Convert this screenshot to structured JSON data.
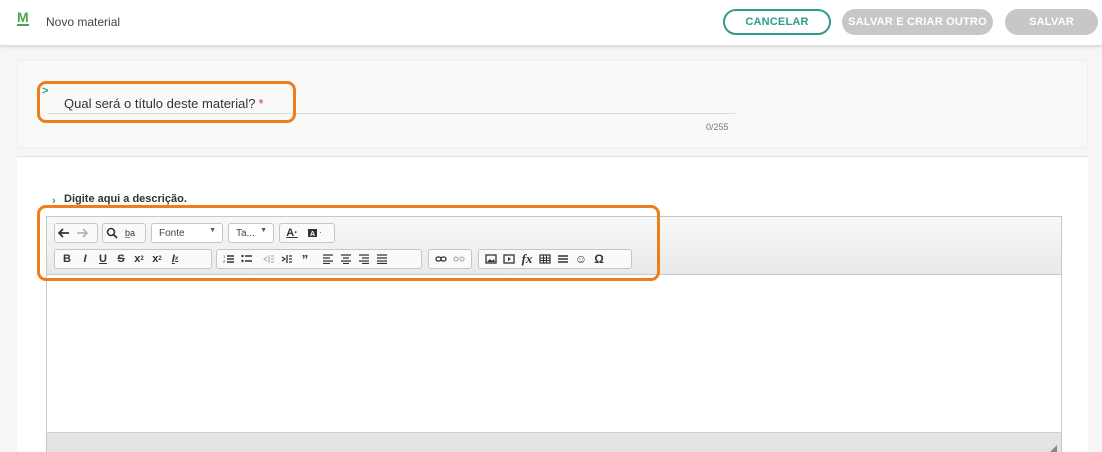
{
  "header": {
    "logo": "M",
    "title": "Novo material",
    "cancel_label": "CANCELAR",
    "save_new_label": "SALVAR E CRIAR OUTRO",
    "save_label": "SALVAR"
  },
  "title_field": {
    "label": "Qual será o título deste material?",
    "required_mark": "*",
    "counter": "0/255"
  },
  "description": {
    "label": "Digite aqui a descrição."
  },
  "editor": {
    "font_combo": "Fonte",
    "size_combo": "Ta...",
    "toolbar_row1": [
      "undo-icon",
      "redo-icon",
      "find-icon",
      "replace-icon",
      "font-combo",
      "size-combo",
      "text-color-icon",
      "bg-color-icon"
    ],
    "toolbar_row2": [
      "bold",
      "italic",
      "underline",
      "strike",
      "subscript",
      "superscript",
      "remove-format",
      "numbered-list",
      "bulleted-list",
      "outdent",
      "indent",
      "blockquote",
      "align-left",
      "align-center",
      "align-right",
      "justify",
      "link",
      "unlink",
      "image",
      "iframe",
      "formula",
      "table",
      "horizontal-rule",
      "smiley",
      "special-char"
    ]
  },
  "colors": {
    "accent": "#2e9c8c",
    "logo_green": "#4aa84a",
    "disabled_button": "#c7c7c7",
    "highlight": "#f07d1c",
    "required": "#dd3333"
  }
}
